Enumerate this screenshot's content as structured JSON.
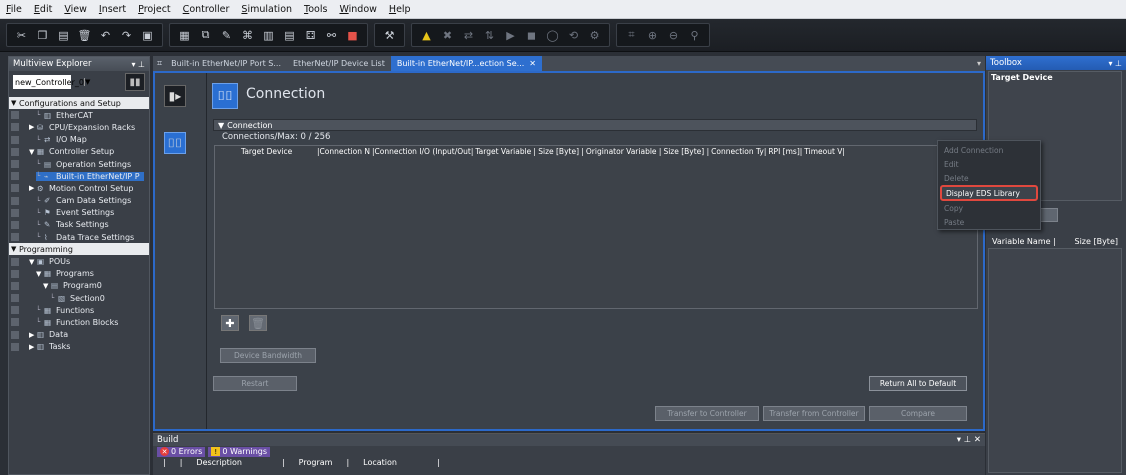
{
  "menu": [
    "File",
    "Edit",
    "View",
    "Insert",
    "Project",
    "Controller",
    "Simulation",
    "Tools",
    "Window",
    "Help"
  ],
  "explorer": {
    "title": "Multiview Explorer",
    "controller": "new_Controller_0",
    "tree": [
      {
        "label": "Configurations and Setup",
        "type": "section",
        "indent": 0
      },
      {
        "label": "EtherCAT",
        "indent": 2,
        "icon": "ethercat-icon"
      },
      {
        "label": "CPU/Expansion Racks",
        "indent": 1,
        "icon": "rack-icon",
        "expander": "collapsed"
      },
      {
        "label": "I/O Map",
        "indent": 2,
        "icon": "io-map-icon"
      },
      {
        "label": "Controller Setup",
        "indent": 1,
        "icon": "controller-setup-icon",
        "expander": "expanded"
      },
      {
        "label": "Operation Settings",
        "indent": 2,
        "icon": "operation-settings-icon"
      },
      {
        "label": "Built-in EtherNet/IP P",
        "indent": 2,
        "icon": "ethernet-ip-icon",
        "selected": true
      },
      {
        "label": "Motion Control Setup",
        "indent": 1,
        "icon": "motion-icon",
        "expander": "collapsed"
      },
      {
        "label": "Cam Data Settings",
        "indent": 2,
        "icon": "cam-icon"
      },
      {
        "label": "Event Settings",
        "indent": 2,
        "icon": "event-icon"
      },
      {
        "label": "Task Settings",
        "indent": 2,
        "icon": "task-icon"
      },
      {
        "label": "Data Trace Settings",
        "indent": 2,
        "icon": "data-trace-icon"
      },
      {
        "label": "Programming",
        "type": "section",
        "indent": 0
      },
      {
        "label": "POUs",
        "indent": 1,
        "icon": "pou-icon",
        "expander": "expanded"
      },
      {
        "label": "Programs",
        "indent": 2,
        "icon": "programs-icon",
        "expander": "expanded"
      },
      {
        "label": "Program0",
        "indent": 3,
        "icon": "program-icon",
        "expander": "expanded"
      },
      {
        "label": "Section0",
        "indent": 4,
        "icon": "section-icon"
      },
      {
        "label": "Functions",
        "indent": 2,
        "icon": "functions-icon"
      },
      {
        "label": "Function Blocks",
        "indent": 2,
        "icon": "function-blocks-icon"
      },
      {
        "label": "Data",
        "indent": 1,
        "icon": "data-icon",
        "expander": "collapsed"
      },
      {
        "label": "Tasks",
        "indent": 1,
        "icon": "tasks-icon",
        "expander": "collapsed"
      }
    ]
  },
  "tabs": [
    {
      "label": "Built-in EtherNet/IP Port S..."
    },
    {
      "label": "EtherNet/IP Device List"
    },
    {
      "label": "Built-in EtherNet/IP...ection Se...",
      "active": true
    }
  ],
  "editor": {
    "title": "Connection",
    "section_label": "Connection",
    "count_label": "Connections/Max: 0 / 256",
    "columns": [
      "Target Device",
      "|Connection N",
      "|Connection I/O (Input/Out|",
      "Target Variable",
      "| Size [Byte] |",
      "Originator Variable |",
      "Size [Byte] |",
      "Connection Ty|",
      "RPI [ms]|",
      "Timeout V|"
    ],
    "device_bandwidth": "Device Bandwidth",
    "restart": "Restart",
    "return_default": "Return All to Default",
    "transfer_to": "Transfer to Controller",
    "transfer_from": "Transfer from Controller",
    "compare": "Compare"
  },
  "context_menu": [
    {
      "label": "Add Connection",
      "enabled": false
    },
    {
      "label": "Edit",
      "enabled": false
    },
    {
      "label": "Delete",
      "enabled": false
    },
    {
      "label": "Display EDS Library",
      "enabled": true,
      "highlighted": true
    },
    {
      "label": "Copy",
      "enabled": false
    },
    {
      "label": "Paste",
      "enabled": false
    }
  ],
  "toolbox": {
    "title": "Toolbox",
    "target_device": "Target Device",
    "var_name_col": "Variable Name |",
    "size_col": "Size [Byte]"
  },
  "build": {
    "title": "Build",
    "errors": "0 Errors",
    "warnings": "0 Warnings",
    "columns": [
      "Description",
      "Program",
      "Location"
    ]
  }
}
